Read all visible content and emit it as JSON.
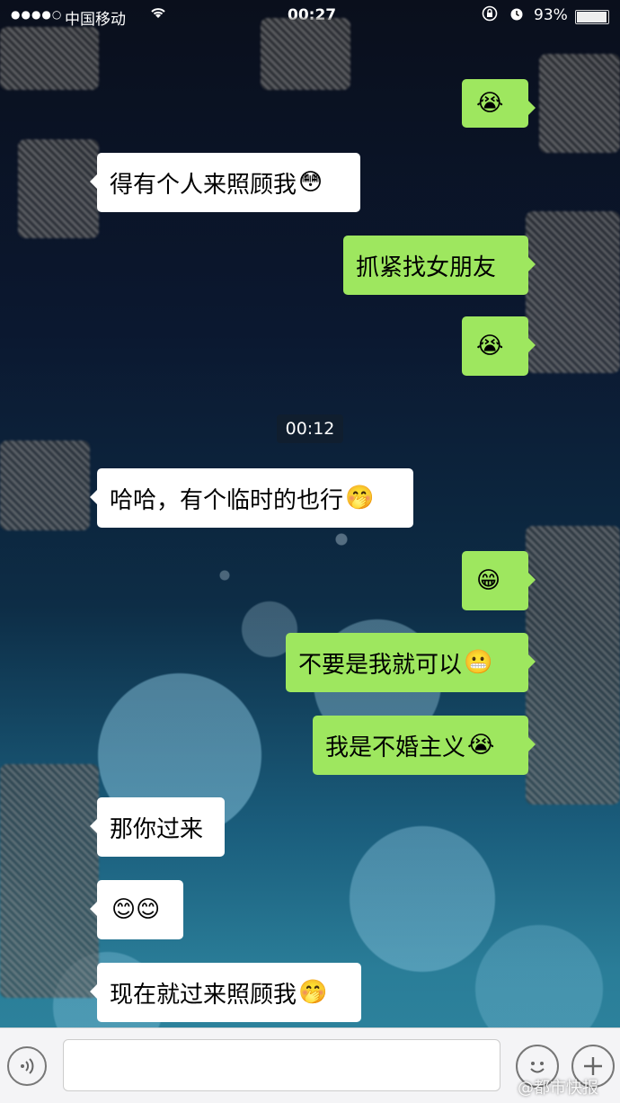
{
  "status_bar": {
    "signal": "●●●●○",
    "carrier": "中国移动",
    "wifi_icon": "wifi-icon",
    "time": "00:27",
    "battery_percent": "93%",
    "battery_level": 0.93
  },
  "messages": [
    {
      "side": "out",
      "text": "",
      "emoji": "😭"
    },
    {
      "side": "in",
      "text": "得有个人来照顾我",
      "emoji": "😳"
    },
    {
      "side": "out",
      "text": "抓紧找女朋友",
      "emoji": ""
    },
    {
      "side": "out",
      "text": "",
      "emoji": "😭"
    },
    {
      "side": "in",
      "text": "哈哈，有个临时的也行",
      "emoji": "🤭"
    },
    {
      "side": "out",
      "text": "",
      "emoji": "😁"
    },
    {
      "side": "out",
      "text": "不要是我就可以",
      "emoji": "😬"
    },
    {
      "side": "out",
      "text": "我是不婚主义",
      "emoji": "😭"
    },
    {
      "side": "in",
      "text": "那你过来",
      "emoji": ""
    },
    {
      "side": "in",
      "text": "",
      "emoji": "😊😊"
    },
    {
      "side": "in",
      "text": "现在就过来照顾我",
      "emoji": "🤭"
    }
  ],
  "timestamp": "00:12",
  "input_bar": {
    "voice_icon": "voice-icon",
    "emoji_icon": "emoji-icon",
    "plus_icon": "plus-icon"
  },
  "watermark": "@都市快报"
}
